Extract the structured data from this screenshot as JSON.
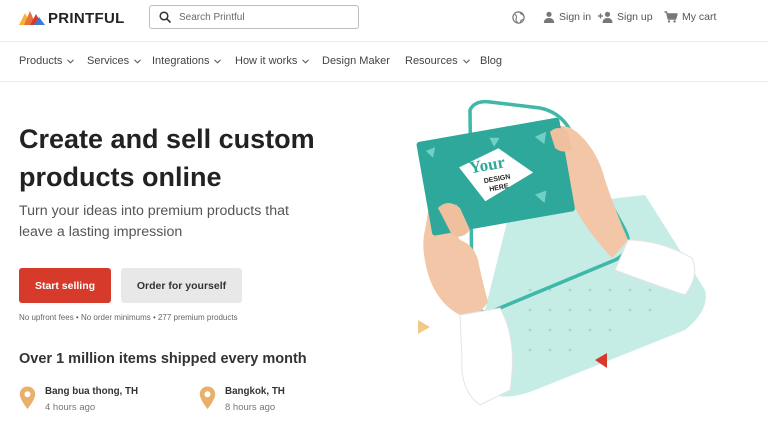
{
  "brand": {
    "name": "PRINTFUL"
  },
  "header": {
    "search_placeholder": "Search Printful",
    "sign_in": "Sign in",
    "sign_up": "Sign up",
    "cart": "My cart"
  },
  "nav": {
    "items": [
      {
        "label": "Products"
      },
      {
        "label": "Services"
      },
      {
        "label": "Integrations"
      },
      {
        "label": "How it works"
      },
      {
        "label": "Design Maker"
      },
      {
        "label": "Resources"
      },
      {
        "label": "Blog"
      }
    ]
  },
  "hero": {
    "title": "Create and sell custom products online",
    "subtitle": "Turn your ideas into premium products that leave a lasting impression",
    "primary_cta": "Start selling",
    "secondary_cta": "Order for yourself",
    "fineprint": "No upfront fees • No order minimums • 277 premium products",
    "shipped_heading": "Over 1 million items shipped every month"
  },
  "shipments": [
    {
      "city": "Bang bua thong, TH",
      "time": "4 hours ago"
    },
    {
      "city": "Bangkok, TH",
      "time": "8 hours ago"
    }
  ],
  "card": {
    "line1": "Your",
    "line2": "DESIGN",
    "line3": "HERE"
  },
  "colors": {
    "accent_red": "#d63a2a",
    "teal": "#2fa99a",
    "mint": "#bfeae3",
    "pin": "#e8b06a"
  },
  "icons": {
    "globe": "globe-icon",
    "user": "user-icon",
    "user_plus": "user-plus-icon",
    "cart": "cart-icon",
    "search": "search-icon",
    "pin": "map-pin-icon"
  }
}
